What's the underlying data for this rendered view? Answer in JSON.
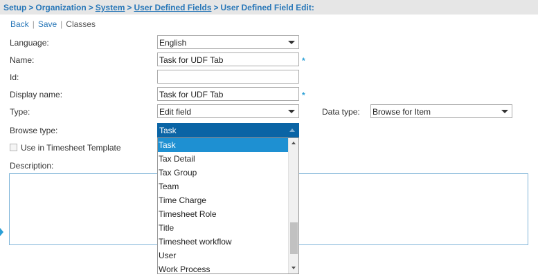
{
  "breadcrumb": {
    "setup": "Setup",
    "organization": "Organization",
    "system": "System",
    "user_defined_fields": "User Defined Fields",
    "current": "User Defined Field Edit:",
    "separator": ">"
  },
  "actions": {
    "back": "Back",
    "save": "Save",
    "classes": "Classes",
    "separator": "|"
  },
  "form": {
    "language": {
      "label": "Language:",
      "value": "English"
    },
    "name": {
      "label": "Name:",
      "value": "Task for UDF Tab",
      "required_mark": "*"
    },
    "id": {
      "label": "Id:",
      "value": ""
    },
    "display_name": {
      "label": "Display name:",
      "value": "Task for UDF Tab",
      "required_mark": "*"
    },
    "type": {
      "label": "Type:",
      "value": "Edit field"
    },
    "data_type": {
      "label": "Data type:",
      "value": "Browse for Item"
    },
    "browse_type": {
      "label": "Browse type:",
      "value": "Task"
    },
    "use_in_timesheet": {
      "label": "Use in Timesheet Template",
      "checked": false
    },
    "description": {
      "label": "Description:",
      "value": ""
    }
  },
  "browse_dropdown": {
    "options": [
      "Task",
      "Tax Detail",
      "Tax Group",
      "Team",
      "Time Charge",
      "Timesheet Role",
      "Title",
      "Timesheet workflow",
      "User",
      "Work Process"
    ],
    "selected": "Task"
  },
  "colors": {
    "link": "#2877b8",
    "required": "#2a9fd6",
    "combo_header": "#0a64a5",
    "selected_option": "#1e90d2"
  }
}
